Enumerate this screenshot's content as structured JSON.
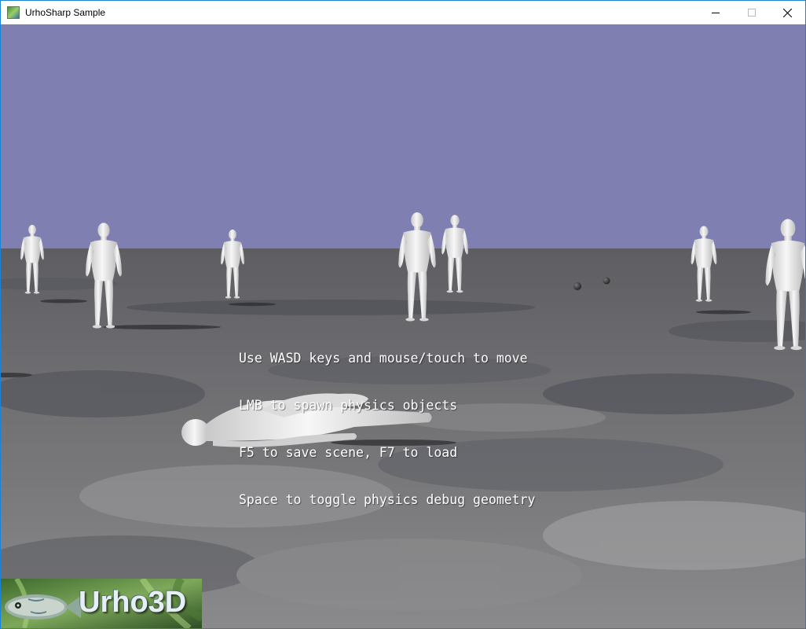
{
  "window": {
    "title": "UrhoSharp Sample",
    "icon": "urho-app-icon",
    "controls": [
      "minimize-icon",
      "maximize-icon",
      "close-icon"
    ]
  },
  "scene": {
    "sky_color": "#7f7fb1",
    "ground_color": "#6e6e70",
    "instructions": [
      "Use WASD keys and mouse/touch to move",
      "LMB to spawn physics objects",
      "F5 to save scene, F7 to load",
      "Space to toggle physics debug geometry"
    ]
  },
  "logo": {
    "text": "Urho3D"
  }
}
